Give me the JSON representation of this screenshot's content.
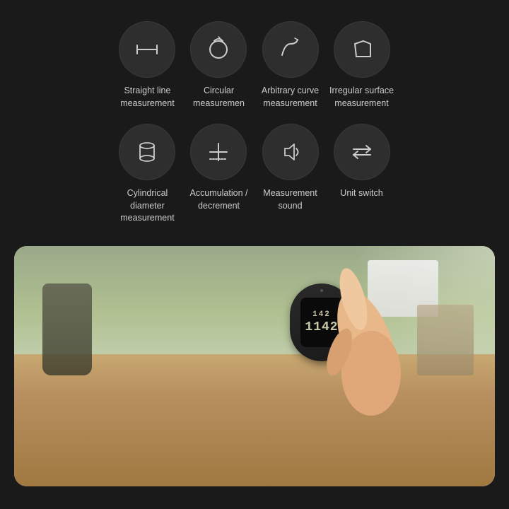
{
  "background_color": "#1a1a1a",
  "features": [
    {
      "id": "straight-line",
      "label": "Straight line\nmeasurement",
      "icon_type": "straight-line-icon"
    },
    {
      "id": "circular",
      "label": "Circular\nmeasuremen",
      "icon_type": "circular-icon"
    },
    {
      "id": "arbitrary-curve",
      "label": "Arbitrary curve\nmeasurement",
      "icon_type": "arbitrary-curve-icon"
    },
    {
      "id": "irregular-surface",
      "label": "Irregular surface\nmeasurement",
      "icon_type": "irregular-surface-icon"
    },
    {
      "id": "cylindrical",
      "label": "Cylindrical\ndiameter\nmeasurement",
      "icon_type": "cylindrical-icon"
    },
    {
      "id": "accumulation",
      "label": "Accumulation /\ndecrement",
      "icon_type": "accumulation-icon"
    },
    {
      "id": "measurement-sound",
      "label": "Measurement\nsound",
      "icon_type": "sound-icon"
    },
    {
      "id": "unit-switch",
      "label": "Unit switch",
      "icon_type": "unit-switch-icon"
    }
  ],
  "device": {
    "display_top": "142",
    "display_main": "1142"
  }
}
